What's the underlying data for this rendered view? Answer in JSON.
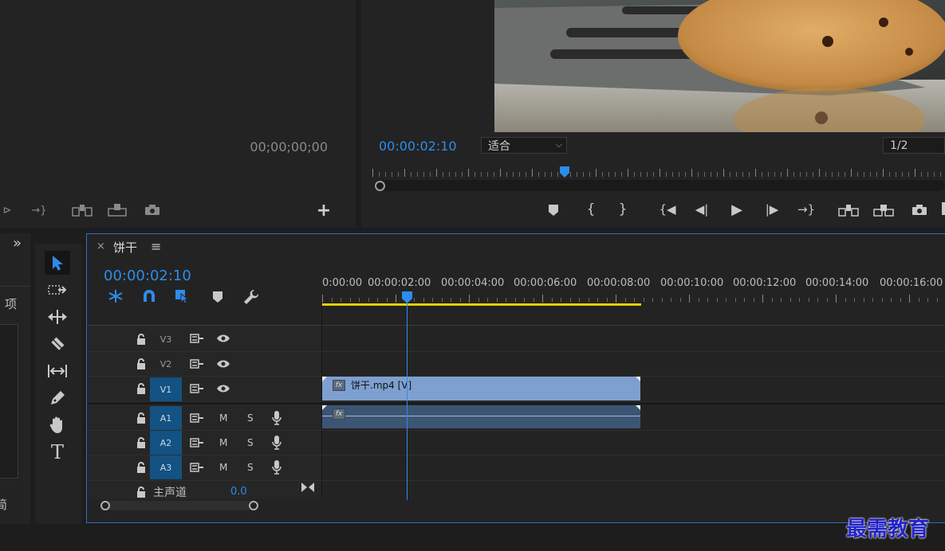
{
  "source_monitor": {
    "timecode": "00;00;00;00"
  },
  "program_monitor": {
    "timecode": "00:00:02:10",
    "fit_select": "适合",
    "resolution_select": "1/2"
  },
  "timeline": {
    "tab_title": "饼干",
    "close_label": "×",
    "menu_label": "≡",
    "timecode": "00:00:02:10",
    "ruler_labels": [
      "0:00:00",
      "00:00:02:00",
      "00:00:04:00",
      "00:00:06:00",
      "00:00:08:00",
      "00:00:10:00",
      "00:00:12:00",
      "00:00:14:00",
      "00:00:16:00"
    ],
    "tracks": {
      "v3": "V3",
      "v2": "V2",
      "v1": "V1",
      "a1": "A1",
      "a2": "A2",
      "a3": "A3"
    },
    "mute_label": "M",
    "solo_label": "S",
    "master_label": "主声道",
    "master_value": "0.0",
    "video_clip_label": "饼干.mp4 [V]",
    "fx_label": "fx"
  },
  "project_panel": {
    "chevron": "»",
    "label_fragment": "项",
    "bottom_fragment": "简"
  },
  "watermark": "最需教育",
  "colors": {
    "accent_blue": "#2d8ceb",
    "track_active": "#135282",
    "video_clip": "#7ea0d0",
    "audio_clip": "#3c5575",
    "work_area": "#e3d200",
    "playhead": "#2d8ceb",
    "watermark": "#2323c8"
  }
}
